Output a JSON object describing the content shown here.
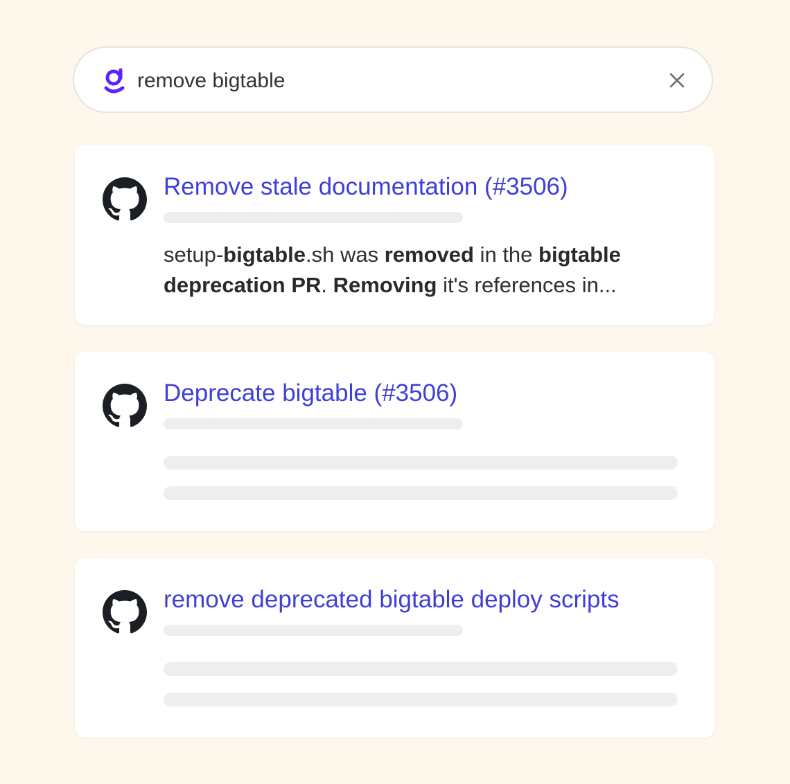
{
  "search": {
    "query": "remove bigtable",
    "logo_icon": "glean-logo-icon",
    "clear_icon": "close-icon",
    "accent": "#5b21ff"
  },
  "results": [
    {
      "icon": "github-icon",
      "title": "Remove stale documentation (#3506)",
      "snippet": {
        "line1": [
          {
            "text": "setup-",
            "bold": false
          },
          {
            "text": "bigtable",
            "bold": true
          },
          {
            "text": ".sh was ",
            "bold": false
          },
          {
            "text": "removed",
            "bold": true
          },
          {
            "text": " in the ",
            "bold": false
          },
          {
            "text": "bigtable",
            "bold": true
          }
        ],
        "line2": [
          {
            "text": "deprecation PR",
            "bold": true
          },
          {
            "text": ". ",
            "bold": false
          },
          {
            "text": "Removing",
            "bold": true
          },
          {
            "text": " it's references in...",
            "bold": false
          }
        ]
      }
    },
    {
      "icon": "github-icon",
      "title": "Deprecate bigtable (#3506)"
    },
    {
      "icon": "github-icon",
      "title": "remove deprecated bigtable deploy scripts"
    }
  ],
  "colors": {
    "background": "#fdf7ec",
    "title_link": "#3f3fd8",
    "placeholder_bar": "#eeeeee"
  }
}
